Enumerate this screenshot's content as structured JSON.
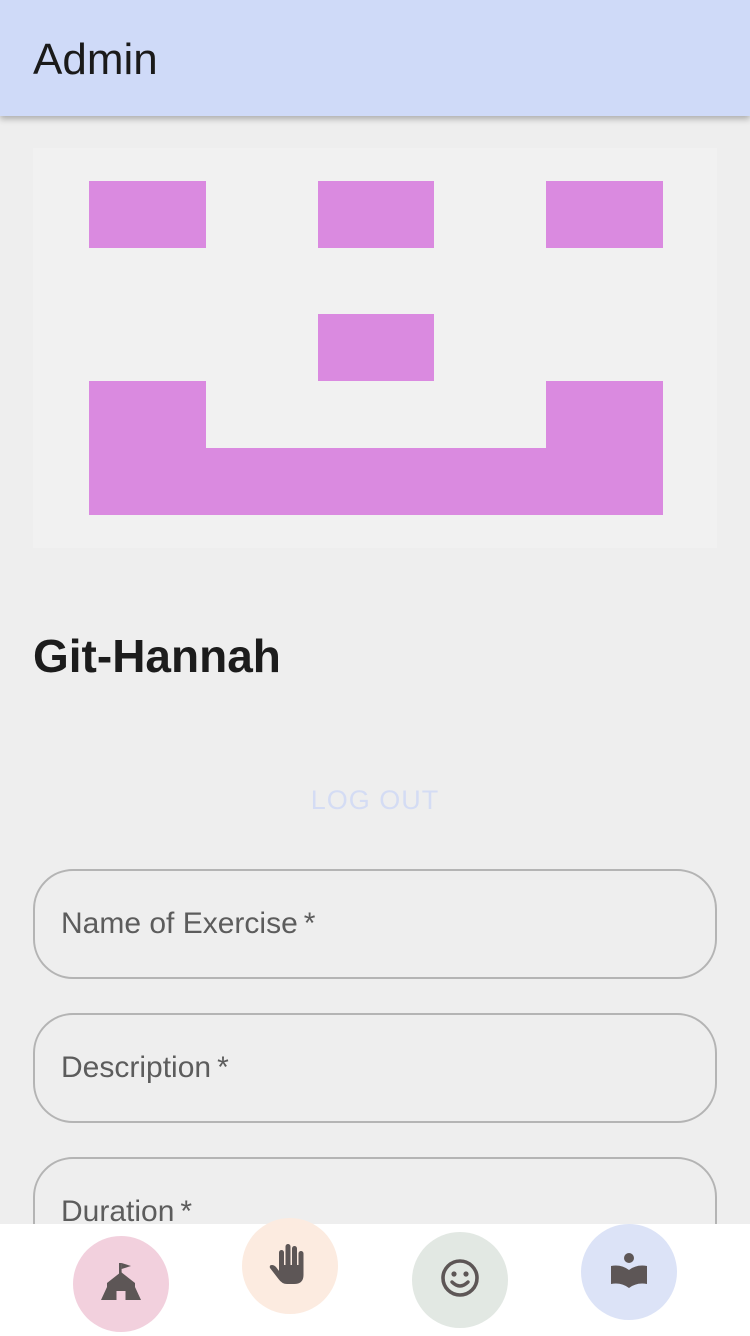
{
  "app_bar": {
    "title": "Admin"
  },
  "profile": {
    "username": "Git-Hannah",
    "avatar_color": "#da8ae0",
    "logout_label": "LOG OUT"
  },
  "form": {
    "fields": [
      {
        "label": "Name of Exercise",
        "required_mark": "*"
      },
      {
        "label": "Description",
        "required_mark": "*"
      },
      {
        "label": "Duration",
        "required_mark": "*"
      }
    ]
  },
  "bottom_nav": {
    "items": [
      {
        "icon": "school-icon",
        "color": "#f2d0dd"
      },
      {
        "icon": "hand-icon",
        "color": "#fcebe0"
      },
      {
        "icon": "smiley-icon",
        "color": "#e2e8e3"
      },
      {
        "icon": "reading-icon",
        "color": "#dce3f7"
      }
    ]
  }
}
